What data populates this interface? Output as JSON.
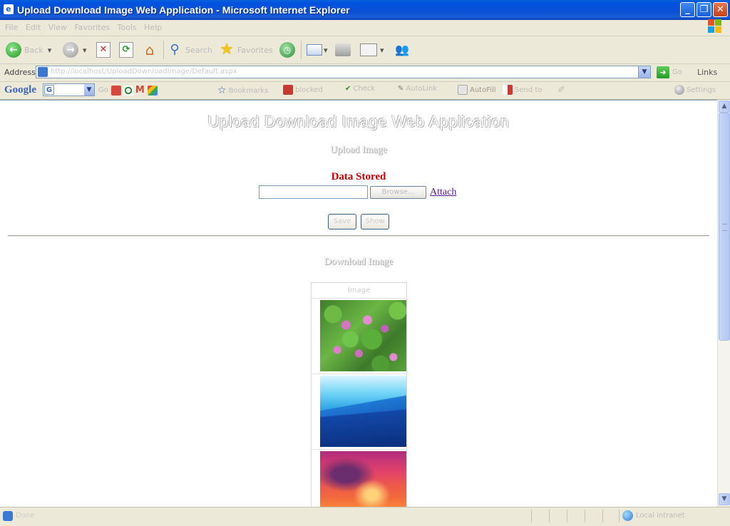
{
  "window": {
    "title": "Upload Download Image Web Application - Microsoft Internet Explorer",
    "controls": [
      "_",
      "❐",
      "✕"
    ]
  },
  "menu": {
    "items": [
      "File",
      "Edit",
      "View",
      "Favorites",
      "Tools",
      "Help"
    ]
  },
  "toolbar": {
    "back_label": "Back",
    "search_label": "Search",
    "favorites_label": "Favorites"
  },
  "address": {
    "label": "Address",
    "url": "http://localhost/UploadDownloadImage/Default.aspx",
    "go_label": "Go",
    "links_label": "Links"
  },
  "googlebar": {
    "logo": "Google",
    "go_label": "Go",
    "bookmarks_label": "Bookmarks",
    "popups_label": "blocked",
    "check_label": "Check",
    "autolink_label": "AutoLink",
    "autofill_label": "AutoFill",
    "sendto_label": "Send to",
    "settings_label": "Settings"
  },
  "page": {
    "title": "Upload Download Image Web Application",
    "upload_heading": "Upload Image",
    "status_message": "Data Stored",
    "browse_label": "Browse...",
    "attach_label": "Attach",
    "save_label": "Save",
    "show_label": "Show",
    "download_heading": "Download Image",
    "table_header": "Image"
  },
  "status": {
    "text": "Done",
    "zone": "Local intranet"
  },
  "colors": {
    "status_message": "#cc0000",
    "link": "#551a8b",
    "titlebar": "#0a4fd3"
  }
}
